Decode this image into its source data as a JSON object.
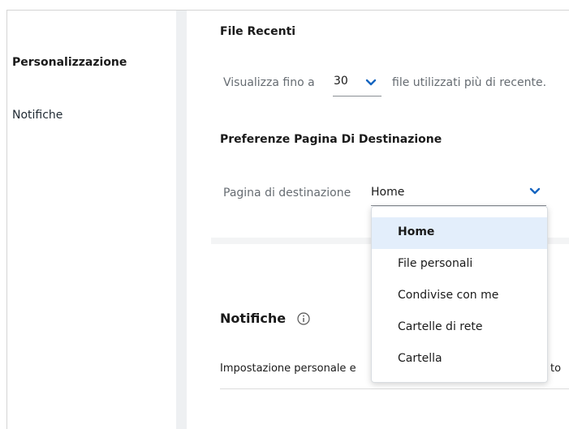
{
  "sidebar": {
    "items": [
      {
        "label": "Personalizzazione",
        "active": true
      },
      {
        "label": "Notifiche",
        "active": false
      }
    ]
  },
  "recent_files": {
    "title": "File Recenti",
    "prefix": "Visualizza fino a",
    "count_value": "30",
    "suffix": "file utilizzati più di recente."
  },
  "landing": {
    "title": "Preferenze Pagina Di Destinazione",
    "label": "Pagina di destinazione",
    "selected": "Home",
    "options": [
      "Home",
      "File personali",
      "Condivise con me",
      "Cartelle di rete",
      "Cartella"
    ]
  },
  "notifications": {
    "title": "Notifiche",
    "setting_text": "Impostazione personale e",
    "setting_text_tail": "to"
  },
  "colors": {
    "accent": "#1565c0",
    "selected_option_bg": "#e3eefb",
    "separator": "#eef0f2"
  },
  "icons": {
    "chevron": "chevron-down-icon",
    "info": "info-icon"
  }
}
